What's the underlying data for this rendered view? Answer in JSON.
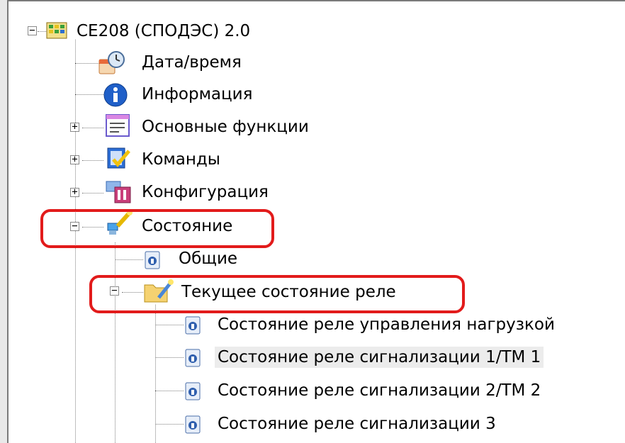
{
  "tree": {
    "root": {
      "label": "CE208 (СПОДЭС) 2.0",
      "icon": "device-grid-icon",
      "expanded": true
    },
    "items": [
      {
        "label": "Дата/время",
        "icon": "clock-icon"
      },
      {
        "label": "Информация",
        "icon": "info-icon"
      },
      {
        "label": "Основные функции",
        "icon": "window-list-icon",
        "expander": "+"
      },
      {
        "label": "Команды",
        "icon": "command-check-icon",
        "expander": "+"
      },
      {
        "label": "Конфигурация",
        "icon": "config-icon",
        "expander": "+"
      },
      {
        "label": "Состояние",
        "icon": "status-wand-icon",
        "expander": "−"
      }
    ],
    "status_children": [
      {
        "label": "Общие",
        "icon": "doc-icon"
      },
      {
        "label": "Текущее состояние реле",
        "icon": "folder-wand-icon",
        "expander": "−"
      }
    ],
    "relay_children": [
      {
        "label": "Состояние реле управления нагрузкой",
        "icon": "doc-icon"
      },
      {
        "label": "Состояние реле сигнализации 1/ТМ 1",
        "icon": "doc-icon",
        "hover": true
      },
      {
        "label": "Состояние реле сигнализации 2/ТМ 2",
        "icon": "doc-icon"
      },
      {
        "label": "Состояние реле сигнализации 3",
        "icon": "doc-icon"
      }
    ]
  },
  "colors": {
    "highlight": "#e21b1b",
    "hover": "#ececec",
    "tree_line": "#808080"
  }
}
